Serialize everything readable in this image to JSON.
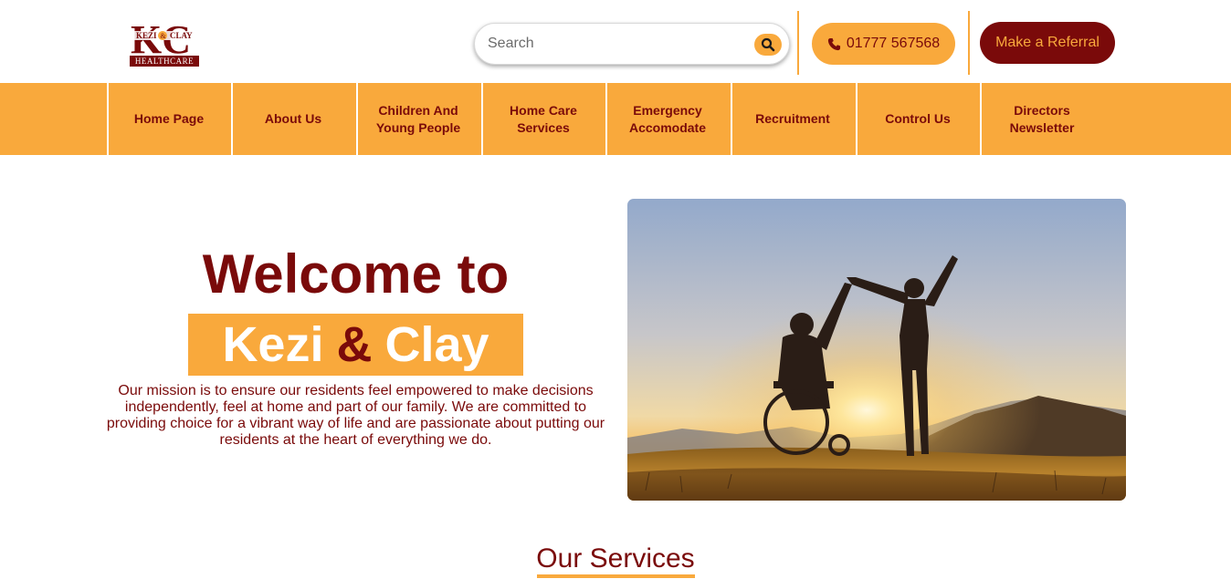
{
  "brand": {
    "logo_letters": "KC",
    "logo_small": "KEZI & CLAY",
    "logo_strip": "HEALTHCARE",
    "primary_color": "#7a0a0a",
    "accent_color": "#f9a93c"
  },
  "header": {
    "search_placeholder": "Search",
    "phone": "01777 567568",
    "referral_label": "Make a Referral"
  },
  "nav": {
    "items": [
      {
        "label": "Home Page"
      },
      {
        "label": "About Us"
      },
      {
        "label": "Children And Young People"
      },
      {
        "label": "Home Care Services"
      },
      {
        "label": "Emergency Accomodate"
      },
      {
        "label": "Recruitment"
      },
      {
        "label": "Control Us"
      },
      {
        "label": "Directors Newsletter"
      }
    ]
  },
  "hero": {
    "welcome": "Welcome to",
    "brand_part1": "Kezi",
    "brand_amp": "&",
    "brand_part2": "Clay",
    "mission": "Our mission is to ensure our residents feel empowered to make decisions independently, feel at home and part of our family. We are committed to providing choice for a vibrant way of life and are passionate about putting our residents at the heart of everything we do."
  },
  "services": {
    "title": "Our Services"
  }
}
